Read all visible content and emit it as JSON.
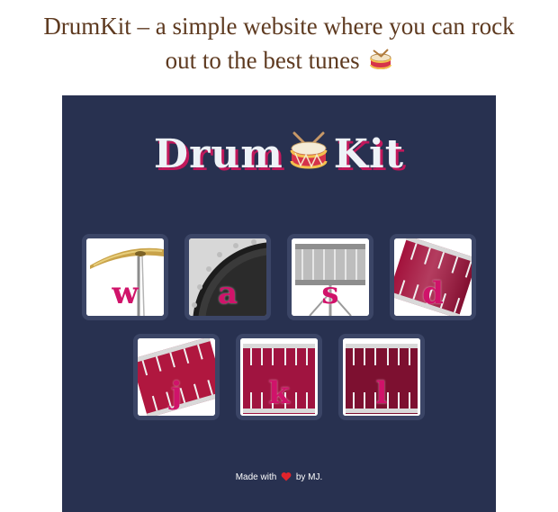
{
  "caption": {
    "line1": "DrumKit – a simple website where you can rock",
    "line2": "out to the best tunes",
    "emoji_icon": "drum-icon"
  },
  "app": {
    "title_left": "Drum",
    "title_right": "Kit",
    "title_icon": "drum-icon",
    "accent_color": "#c2185b",
    "panel_color": "#283150"
  },
  "keys": [
    {
      "letter": "w",
      "sound": "crash",
      "icon": "crash-cymbal-icon"
    },
    {
      "letter": "a",
      "sound": "kick-bass",
      "icon": "kick-drum-icon"
    },
    {
      "letter": "s",
      "sound": "snare",
      "icon": "snare-drum-icon"
    },
    {
      "letter": "d",
      "sound": "tom-1",
      "icon": "tom-drum-icon"
    },
    {
      "letter": "j",
      "sound": "tom-2",
      "icon": "tom-drum-icon"
    },
    {
      "letter": "k",
      "sound": "tom-3",
      "icon": "tom-drum-icon"
    },
    {
      "letter": "l",
      "sound": "tom-4",
      "icon": "tom-drum-icon"
    }
  ],
  "footer": {
    "before": "Made with",
    "heart_icon": "heart-icon",
    "after": "by MJ."
  }
}
